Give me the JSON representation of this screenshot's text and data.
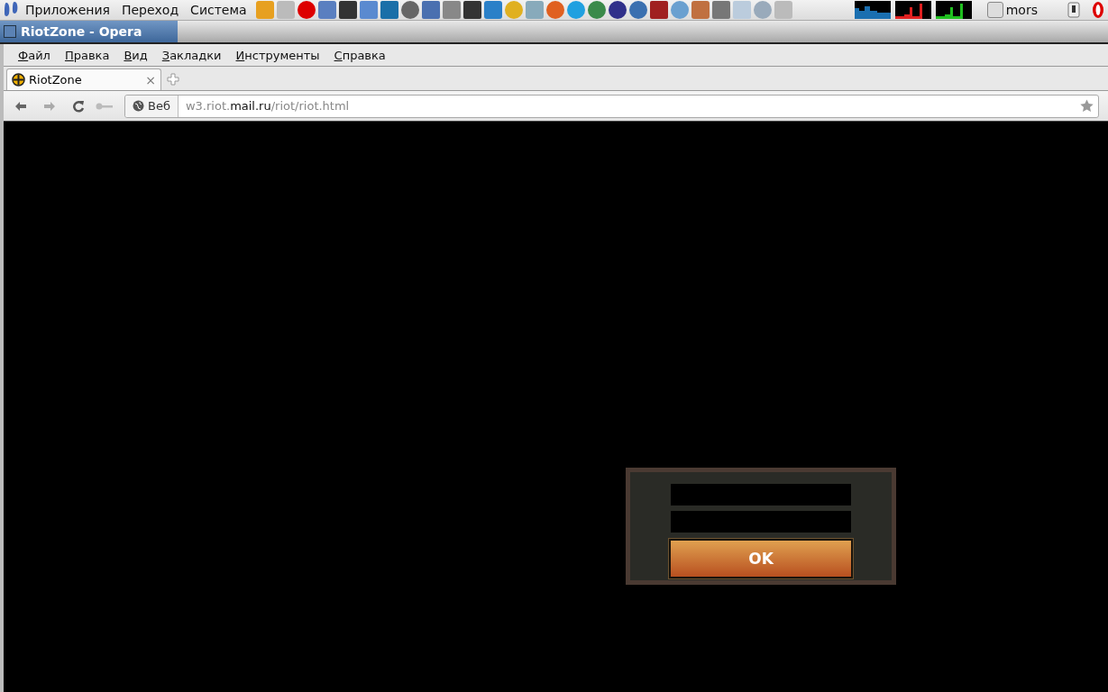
{
  "top_panel": {
    "menus": [
      "Приложения",
      "Переход",
      "Система"
    ],
    "user": "mors"
  },
  "window": {
    "title": "RiotZone - Opera"
  },
  "menu_bar": [
    "Файл",
    "Правка",
    "Вид",
    "Закладки",
    "Инструменты",
    "Справка"
  ],
  "tabs": [
    {
      "label": "RiotZone",
      "selected": true,
      "close": "×"
    }
  ],
  "address_bar": {
    "badge": "Веб",
    "url": "w3.riot.**mail.ru**/riot/riot.html"
  },
  "login_dialog": {
    "button": "OK"
  }
}
